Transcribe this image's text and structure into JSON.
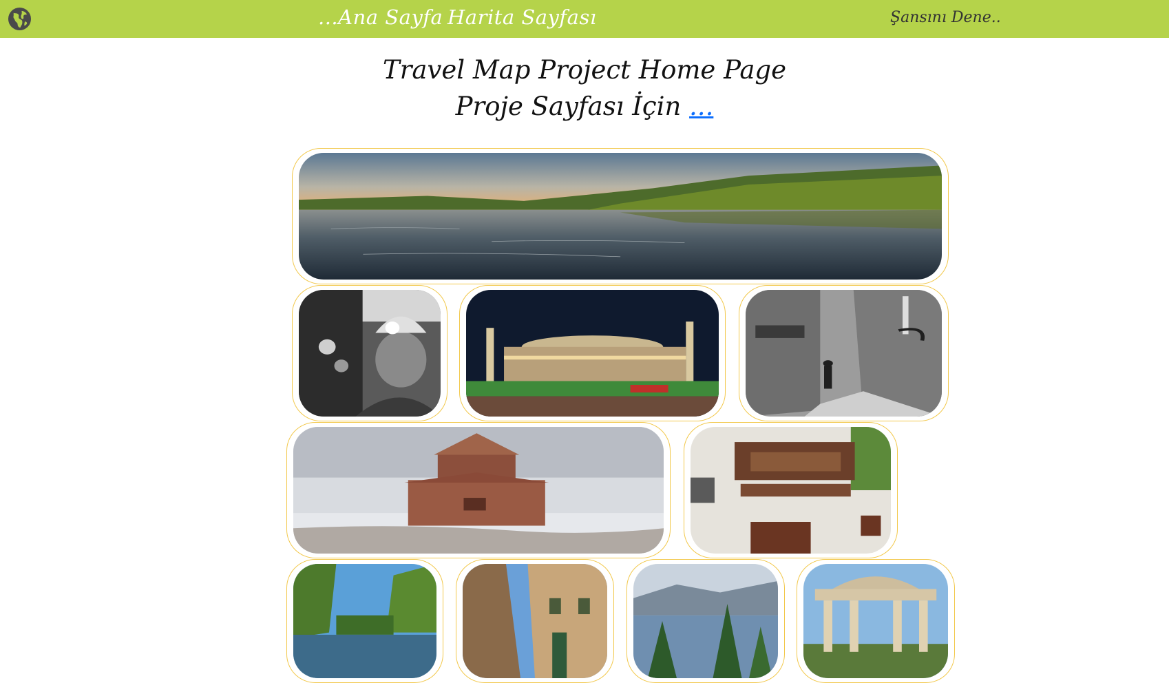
{
  "nav": {
    "home_label": "...Ana Sayfa",
    "map_label": "Harita Sayfası",
    "luck_label": "Şansını Dene.."
  },
  "main": {
    "title": "Travel Map Project Home Page",
    "subtitle_text": "Proje Sayfası İçin ",
    "subtitle_link": "..."
  },
  "colors": {
    "topbar": "#b5d34a",
    "card_border": "#f2c84b",
    "link": "#0d6efd"
  },
  "icons": {
    "logo": "globe-icon"
  }
}
